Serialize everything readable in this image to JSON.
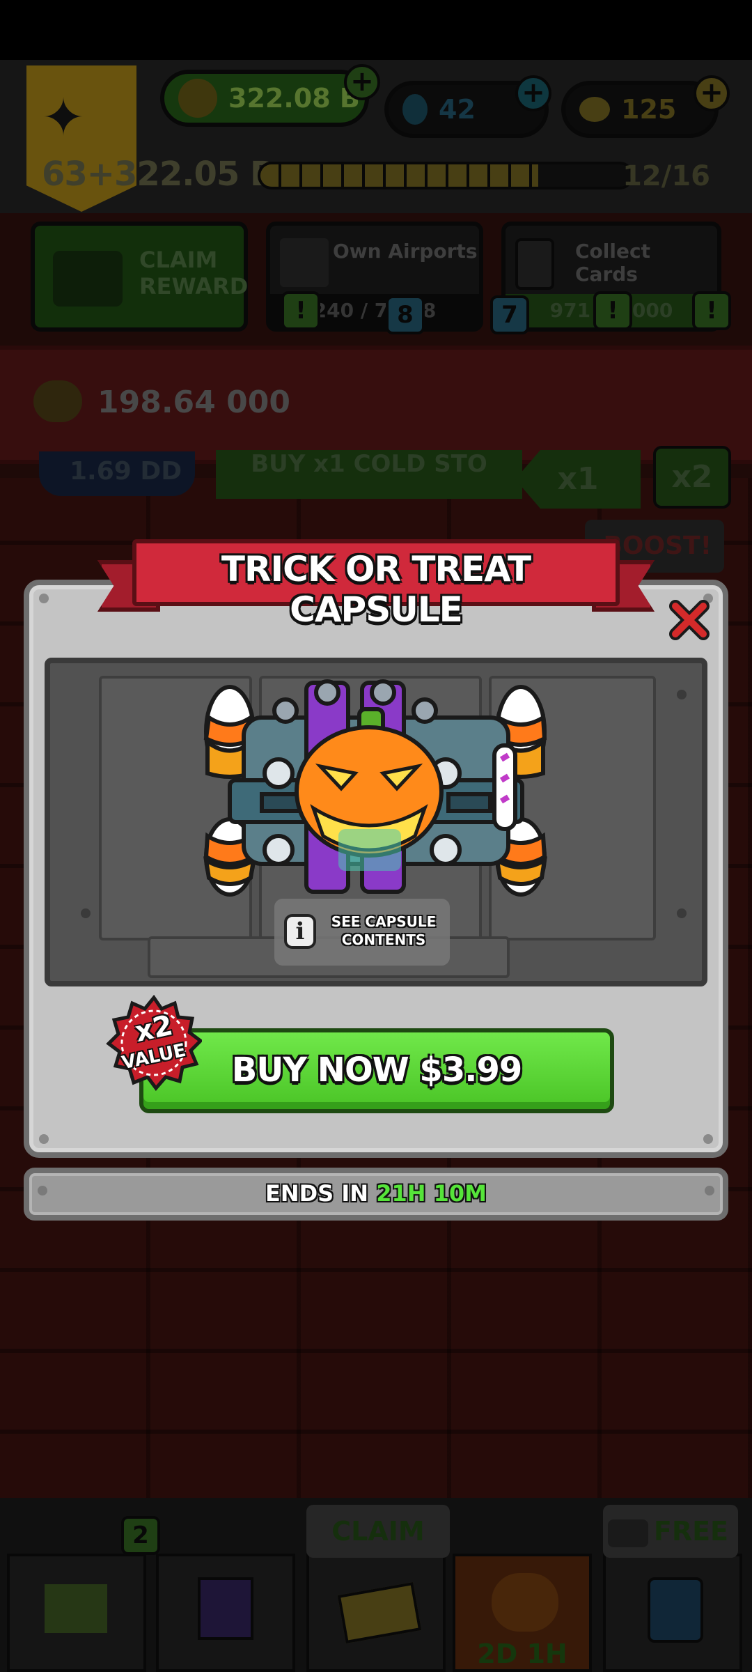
{
  "hud": {
    "cash": "322.08 B",
    "flasks": "42",
    "gold": "125",
    "level_text": "63",
    "xp_text": "+322.05 B",
    "progress_count": "12/16",
    "progress_fraction": 0.75
  },
  "quests": {
    "claim_reward": "CLAIM\nREWARD",
    "own_airports_title": "Own Airports",
    "own_airports_progress": "240 / 7,378",
    "collect_cards_title": "Collect Cards",
    "collect_cards_progress": "971 / 1,000"
  },
  "resources": {
    "potato_value": "198.64 000",
    "badge_1": "!",
    "badge_2": "8",
    "badge_3": "7",
    "badge_4": "!",
    "badge_5": "!"
  },
  "background_buy": {
    "left_value": "1.69 DD",
    "buy_label": "BUY x1 COLD STO",
    "mult_x1": "x1",
    "mult_x2": "x2",
    "boost": "BOOST!"
  },
  "modal": {
    "title": "TRICK OR TREAT CAPSULE",
    "see_contents": "SEE CAPSULE CONTENTS",
    "buy_button": "BUY NOW $3.99",
    "value_badge_top": "x2",
    "value_badge_bottom": "VALUE",
    "ends_in_label": "ENDS IN",
    "ends_in_hours": "21H",
    "ends_in_minutes": "10M"
  },
  "bottom_nav": {
    "flag_badge": "2",
    "claim_label": "CLAIM",
    "free_label": "FREE",
    "event_timer": "2D 1H"
  },
  "colors": {
    "ribbon_red": "#d0293b",
    "buy_green": "#4ac426",
    "timer_green": "#56e43a",
    "close_red": "#d42a2a"
  }
}
